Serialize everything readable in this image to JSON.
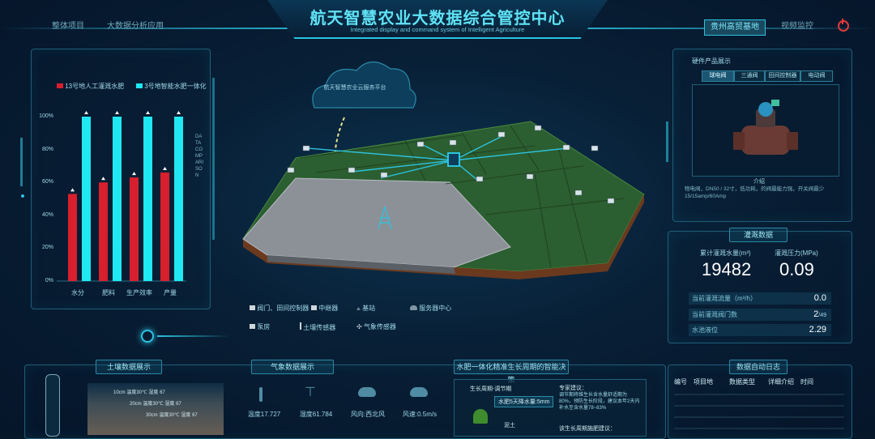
{
  "header": {
    "title": "航天智慧农业大数据综合管控中心",
    "subtitle": "Integrated display and command system of Intelligent Agriculture",
    "nav_left": [
      "整体项目",
      "大数据分析应用"
    ],
    "nav_right": [
      "贵州高贸基地",
      "视频监控"
    ],
    "power_icon": "power-icon"
  },
  "left_chart": {
    "side_label": "DATA COMPARISON",
    "chart_data": {
      "type": "bar",
      "categories": [
        "水分",
        "肥料",
        "生产效率",
        "产量"
      ],
      "series": [
        {
          "name": "13号地人工灌溉水肥",
          "color": "#d81f2e",
          "values": [
            53,
            60,
            63,
            66
          ]
        },
        {
          "name": "3号地智能水肥一体化",
          "color": "#1fe8f2",
          "values": [
            100,
            100,
            100,
            100
          ]
        }
      ],
      "yticks": [
        "100%",
        "80%",
        "60%",
        "40%",
        "20%",
        "0%"
      ],
      "ylim": [
        0,
        100
      ],
      "legend_position": "top",
      "grid": false
    }
  },
  "map": {
    "cloud_label": "航天智慧农业云服务平台",
    "legend": [
      {
        "icon": "valve-controller-icon",
        "label": "阀门、田间控制器"
      },
      {
        "icon": "relay-icon",
        "label": "中继器"
      },
      {
        "icon": "base-station-icon",
        "label": "基站"
      },
      {
        "icon": "server-center-icon",
        "label": "服务器中心"
      },
      {
        "icon": "pump-room-icon",
        "label": "泵房"
      },
      {
        "icon": "soil-sensor-icon",
        "label": "土壤传感器"
      },
      {
        "icon": "weather-sensor-icon",
        "label": "气象传感器"
      }
    ]
  },
  "right_top": {
    "title": "硬件产品展示",
    "tabs": [
      "球电阀",
      "三通阀",
      "田间控制器",
      "电动阀"
    ],
    "intro_title": "介绍",
    "intro_text": "物电阀，DN50 / 32寸，低功耗，的阀最能力强，开关阀最少15/15amp/60Amp"
  },
  "right_mid": {
    "title": "灌溉数据",
    "total_water_label": "累计灌溉水量(m³)",
    "total_water_value": "19482",
    "pressure_label": "灌溉压力(MPa)",
    "pressure_value": "0.09",
    "rows": [
      {
        "label": "当前灌溉流量（m³/h）",
        "value": "0.0"
      },
      {
        "label": "当前灌溉阀门数",
        "value": "2",
        "suffix": "/49"
      },
      {
        "label": "水池液位",
        "value": "2.29"
      }
    ]
  },
  "bottom": {
    "soil_title": "土壤数据展示",
    "soil_layers": [
      "10cm 温度30℃ 湿度 67",
      "20cm 温度30℃ 湿度 67",
      "30cm 温度30℃ 湿度 67"
    ],
    "weather_title": "气象数据展示",
    "weather": [
      {
        "icon": "thermometer-icon",
        "label": "温度17.727"
      },
      {
        "icon": "humidity-sensor-icon",
        "label": "湿度61.784"
      },
      {
        "icon": "cloud-icon",
        "label": "风向:西北风"
      },
      {
        "icon": "wind-cloud-icon",
        "label": "风速:0.5m/s"
      }
    ],
    "decision_title": "水肥一体化精准生长周期的智能决策",
    "stage_label": "生长周期-调节期",
    "stage_sub": "水肥5天降水量:5mm",
    "soil_tag": "泥土",
    "expert_title": "专家建议：",
    "expert_text": "调节期将维生长含水量舒适期为80%，预防生长阶段，建议本年2天内补水至含水量78~83%",
    "expert_title2": "该生长周期施肥建议：",
    "log_title": "数据自动日志",
    "log_headers": [
      "编号",
      "项目地",
      "数据类型",
      "详细介绍",
      "时间"
    ]
  }
}
